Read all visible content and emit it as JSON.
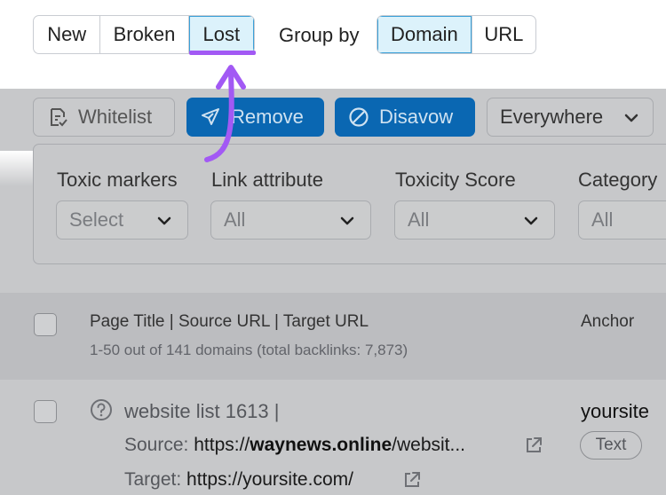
{
  "filters": {
    "status_tabs": [
      "New",
      "Broken",
      "Lost"
    ],
    "selected_status": "Lost",
    "group_by_label": "Group by",
    "group_by_options": [
      "Domain",
      "URL"
    ],
    "selected_group": "Domain"
  },
  "toolbar": {
    "whitelist": "Whitelist",
    "remove": "Remove",
    "disavow": "Disavow",
    "scope": "Everywhere"
  },
  "filter_panel": {
    "toxic_markers": {
      "label": "Toxic markers",
      "value": "Select"
    },
    "link_attribute": {
      "label": "Link attribute",
      "value": "All"
    },
    "toxicity_score": {
      "label": "Toxicity Score",
      "value": "All"
    },
    "category": {
      "label": "Category",
      "value": "All"
    }
  },
  "table": {
    "header_title": "Page Title | Source URL | Target URL",
    "header_sub": "1-50 out of 141 domains (total backlinks: 7,873)",
    "anchor_header": "Anchor",
    "rows": [
      {
        "title": "website list 1613 |",
        "source_label": "Source:",
        "source_prefix": "https://",
        "source_domain": "waynews.online",
        "source_suffix": "/websit...",
        "target_label": "Target:",
        "target_url": "https://yoursite.com/",
        "anchor": "yoursite",
        "anchor_type": "Text"
      }
    ]
  },
  "colors": {
    "accent_purple": "#a259f4",
    "primary_blue": "#0a67b2",
    "selected_tab_bg": "#dcf2fb",
    "dim_overlay": "#c7c8ca"
  },
  "icons": {
    "whitelist": "document-check-icon",
    "remove": "paper-plane-icon",
    "disavow": "prohibited-icon",
    "help": "question-circle-icon",
    "external": "external-link-icon",
    "chevron": "chevron-down-icon"
  }
}
